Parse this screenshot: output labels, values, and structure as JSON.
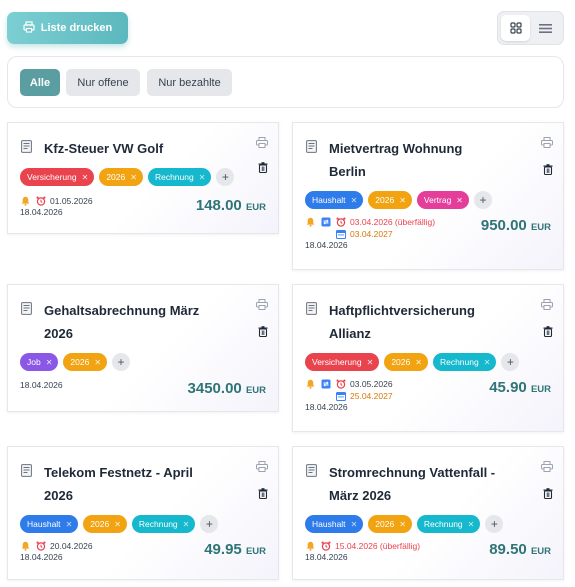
{
  "toolbar": {
    "print_label": "Liste drucken"
  },
  "filters": {
    "all": "Alle",
    "open": "Nur offene",
    "paid": "Nur bezahlte"
  },
  "cards": [
    {
      "title": "Kfz-Steuer VW Golf",
      "tags": [
        "Versicherung",
        "2026",
        "Rechnung"
      ],
      "due": "01.05.2026",
      "created": "18.04.2026",
      "amount": "148.00",
      "currency": "EUR"
    },
    {
      "title": "Mietvertrag Wohnung\nBerlin",
      "tags": [
        "Haushalt",
        "2026",
        "Vertrag"
      ],
      "due": "03.04.2026 (überfällig)",
      "next": "03.04.2027",
      "created": "18.04.2026",
      "amount": "950.00",
      "currency": "EUR"
    },
    {
      "title": "Gehaltsabrechnung März\n2026",
      "tags": [
        "Job",
        "2026"
      ],
      "created": "18.04.2026",
      "amount": "3450.00",
      "currency": "EUR"
    },
    {
      "title": "Haftpflichtversicherung\nAllianz",
      "tags": [
        "Versicherung",
        "2026",
        "Rechnung"
      ],
      "due": "03.05.2026",
      "next": "25.04.2027",
      "created": "18.04.2026",
      "amount": "45.90",
      "currency": "EUR"
    },
    {
      "title": "Telekom Festnetz - April\n2026",
      "tags": [
        "Haushalt",
        "2026",
        "Rechnung"
      ],
      "due": "20.04.2026",
      "created": "18.04.2026",
      "amount": "49.95",
      "currency": "EUR"
    },
    {
      "title": "Stromrechnung Vattenfall -\nMärz 2026",
      "tags": [
        "Haushalt",
        "2026",
        "Rechnung"
      ],
      "due": "15.04.2026 (überfällig)",
      "created": "18.04.2026",
      "amount": "89.50",
      "currency": "EUR"
    }
  ],
  "colors": {
    "accent": "#5a9ea2",
    "amount": "#2f7476",
    "tag_red": "#e9434d",
    "tag_orange": "#f2a311",
    "tag_cyan": "#15b8cc",
    "tag_blue": "#2e7bea",
    "tag_pink": "#e43e9a",
    "tag_purple": "#8b57e6"
  }
}
